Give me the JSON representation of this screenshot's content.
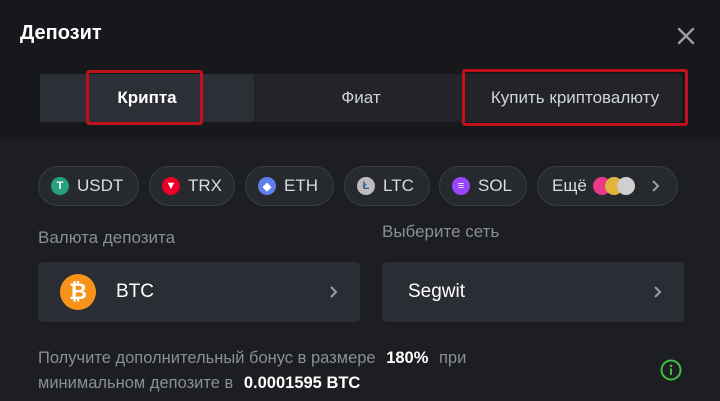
{
  "dialog": {
    "title": "Депозит"
  },
  "tabs": [
    {
      "label": "Крипта",
      "active": true
    },
    {
      "label": "Фиат",
      "active": false
    },
    {
      "label": "Купить криптовалюту",
      "active": false
    }
  ],
  "coins": [
    {
      "label": "USDT",
      "icon": "usdt-icon",
      "color": "#26a17b"
    },
    {
      "label": "TRX",
      "icon": "trx-icon",
      "color": "#eb0029"
    },
    {
      "label": "ETH",
      "icon": "eth-icon",
      "color": "#627eea"
    },
    {
      "label": "LTC",
      "icon": "ltc-icon",
      "color": "#bfbbbb"
    },
    {
      "label": "SOL",
      "icon": "sol-icon",
      "color": "#9945ff"
    },
    {
      "label": "Ещё",
      "icon": "more-coins-icon"
    }
  ],
  "deposit_currency": {
    "label": "Валюта депозита",
    "value": "BTC",
    "icon": "btc-icon",
    "color": "#f7931a"
  },
  "network": {
    "label": "Выберите сеть",
    "value": "Segwit"
  },
  "bonus": {
    "text_1": "Получите дополнительный бонус в размере",
    "percent": "180%",
    "text_2": "при",
    "text_3": "минимальном депозите в",
    "amount": "0.0001595 BTC"
  },
  "colors": {
    "highlight": "#c0121c",
    "accent_green": "#3fbf3f"
  }
}
